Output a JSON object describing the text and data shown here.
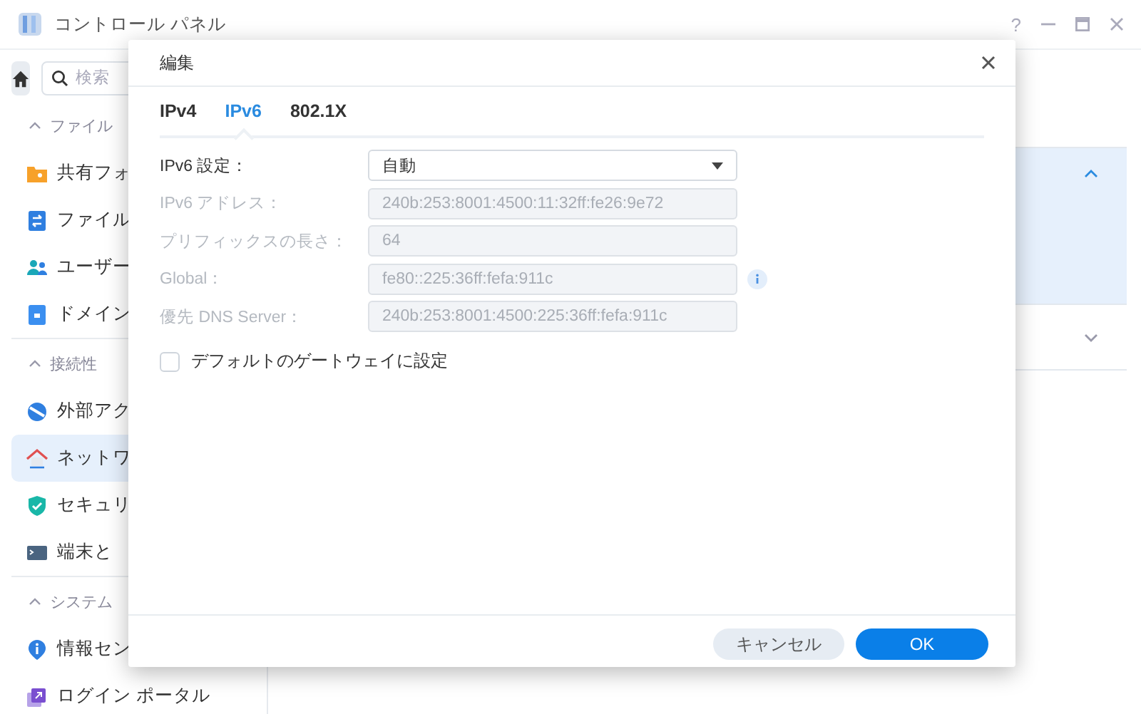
{
  "window": {
    "title": "コントロール パネル",
    "controls": [
      "?"
    ]
  },
  "sidebar": {
    "search": {
      "placeholder": "検索"
    },
    "sections": [
      {
        "title": "ファイル",
        "items": [
          {
            "label": "共有フォ",
            "selected": false
          },
          {
            "label": "ファイル",
            "selected": false
          },
          {
            "label": "ユーザー",
            "selected": false
          },
          {
            "label": "ドメイン",
            "selected": false
          }
        ]
      },
      {
        "title": "接続性",
        "items": [
          {
            "label": "外部アク",
            "selected": false
          },
          {
            "label": "ネットワ",
            "selected": true
          },
          {
            "label": "セキュリ",
            "selected": false
          },
          {
            "label": "端末と",
            "selected": false
          }
        ]
      },
      {
        "title": "システム",
        "items": [
          {
            "label": "情報セン",
            "selected": false
          },
          {
            "label": "ログイン ポータル",
            "selected": false
          }
        ]
      }
    ]
  },
  "panels": [
    {
      "expanded": true
    },
    {
      "expanded": false
    }
  ],
  "dialog": {
    "title": "編集",
    "tabs": [
      {
        "label": "IPv4",
        "selected": false
      },
      {
        "label": "IPv6",
        "selected": true
      },
      {
        "label": "802.1X",
        "selected": false
      }
    ],
    "fields": [
      {
        "kind": "select",
        "label": "IPv6 設定：",
        "value": "自動",
        "disabled": false
      },
      {
        "kind": "text",
        "label": "IPv6 アドレス：",
        "value": "240b:253:8001:4500:11:32ff:fe26:9e72",
        "disabled": true
      },
      {
        "kind": "text",
        "label": "プリフィックスの長さ：",
        "value": "64",
        "disabled": true
      },
      {
        "kind": "text",
        "label": "Global：",
        "value": "fe80::225:36ff:fefa:911c",
        "disabled": true,
        "info": true
      },
      {
        "kind": "text",
        "label": "優先 DNS Server：",
        "value": "240b:253:8001:4500:225:36ff:fefa:911c",
        "disabled": true
      }
    ],
    "checkbox": {
      "label": "デフォルトのゲートウェイに設定",
      "checked": false
    },
    "buttons": [
      {
        "label": "キャンセル",
        "kind": "secondary"
      },
      {
        "label": "OK",
        "kind": "primary"
      }
    ]
  }
}
